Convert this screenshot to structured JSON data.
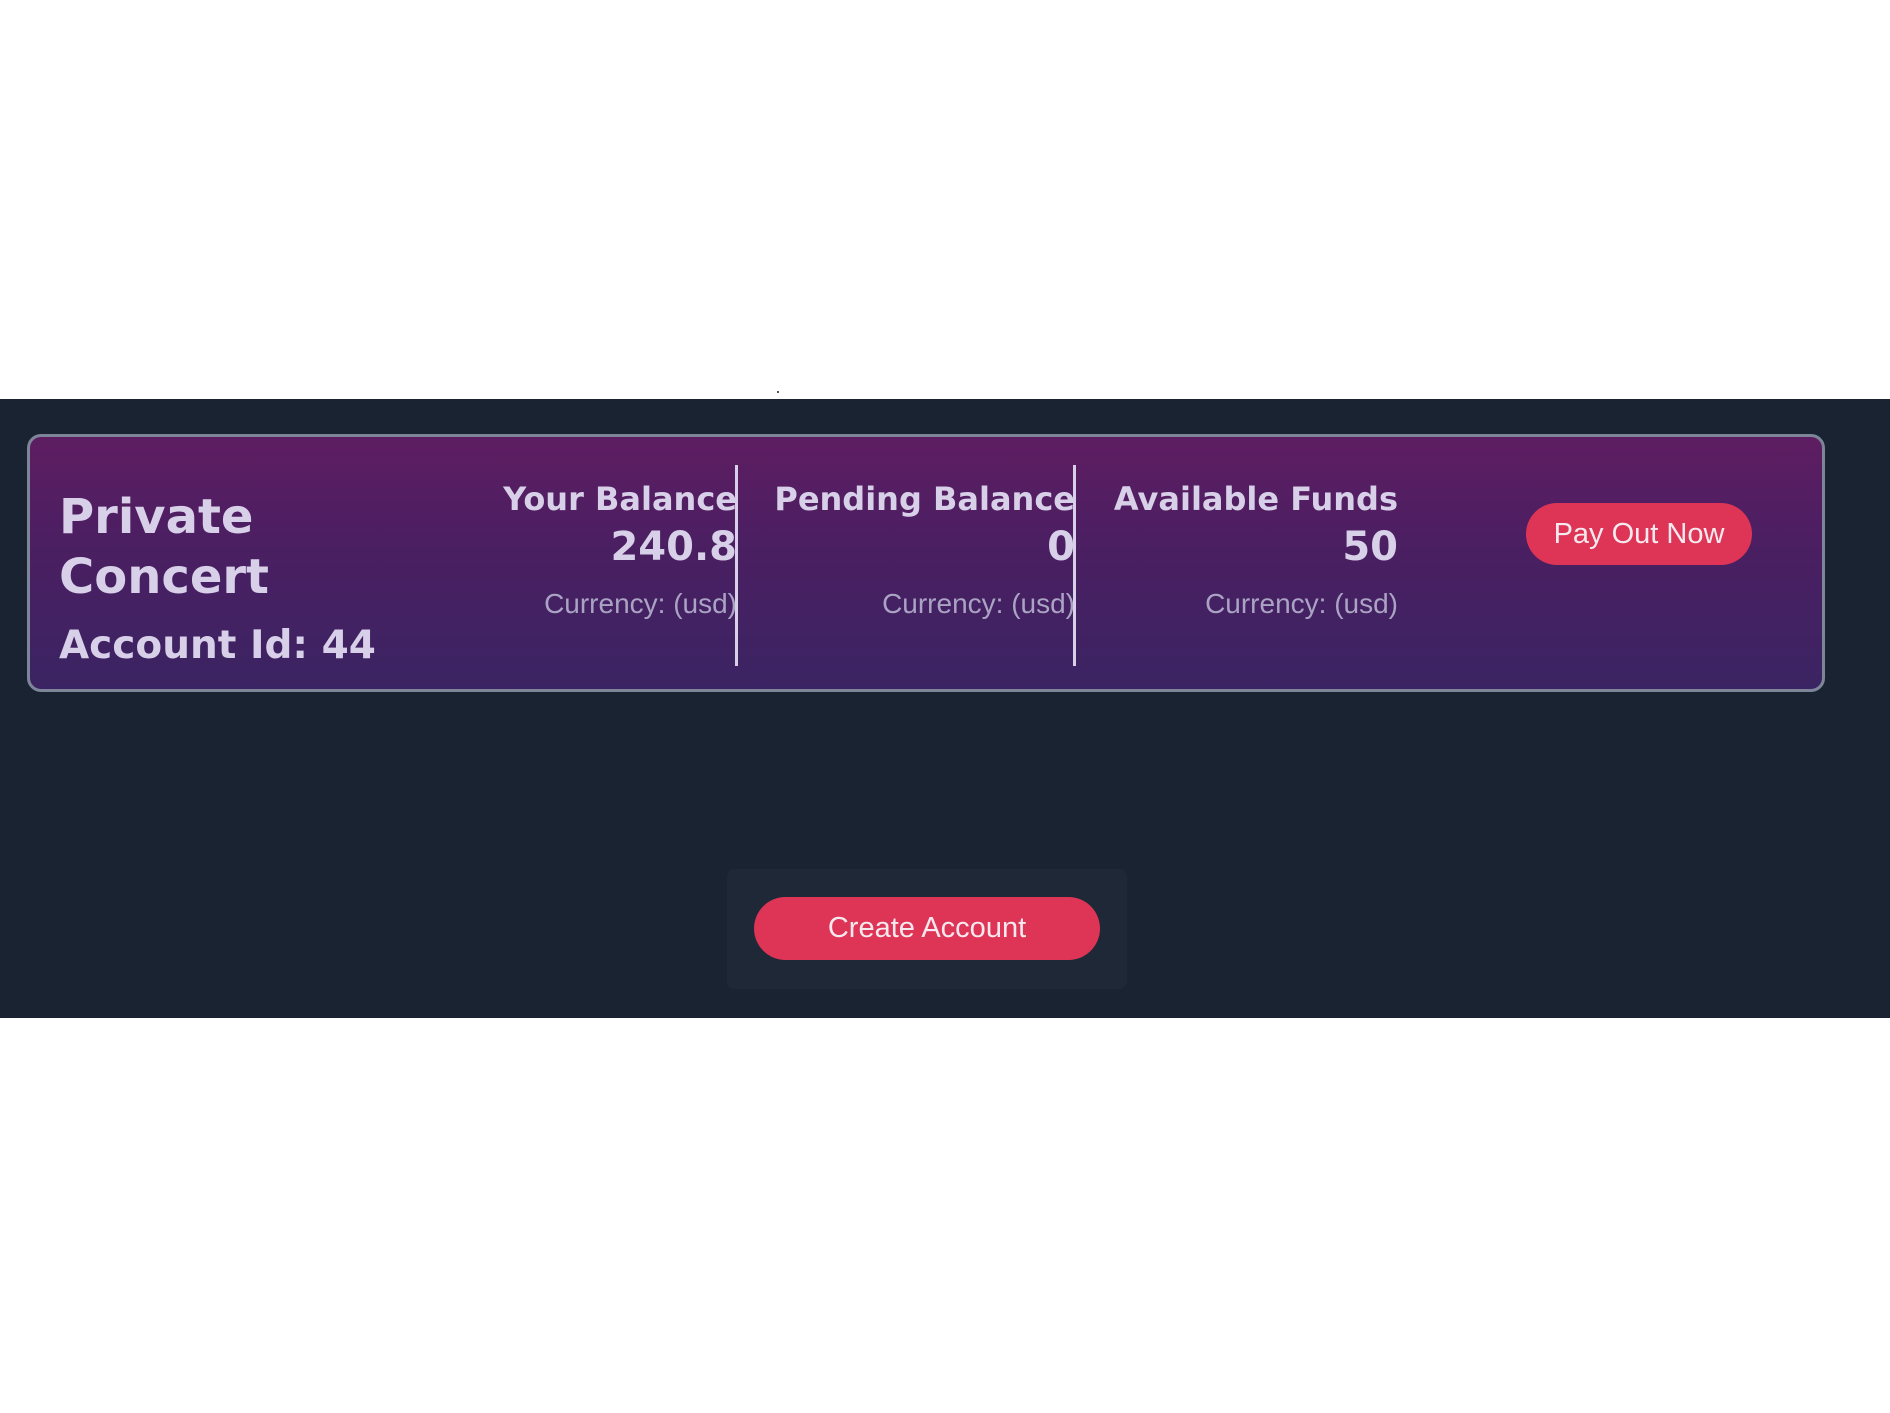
{
  "account": {
    "name_line1": "Private",
    "name_line2": "Concert",
    "account_id_text": "Account Id: 44"
  },
  "balances": [
    {
      "label": "Your Balance",
      "value": "240.8",
      "currency": "Currency: (usd)"
    },
    {
      "label": "Pending Balance",
      "value": "0",
      "currency": "Currency: (usd)"
    },
    {
      "label": "Available Funds",
      "value": "50",
      "currency": "Currency: (usd)"
    }
  ],
  "actions": {
    "payout_label": "Pay Out Now",
    "create_account_label": "Create Account"
  },
  "colors": {
    "background_dark": "#1a2332",
    "card_gradient_top": "#5e1d61",
    "card_gradient_bottom": "#3b2463",
    "accent_button": "#de3556",
    "text_light": "#d8cfe9"
  }
}
